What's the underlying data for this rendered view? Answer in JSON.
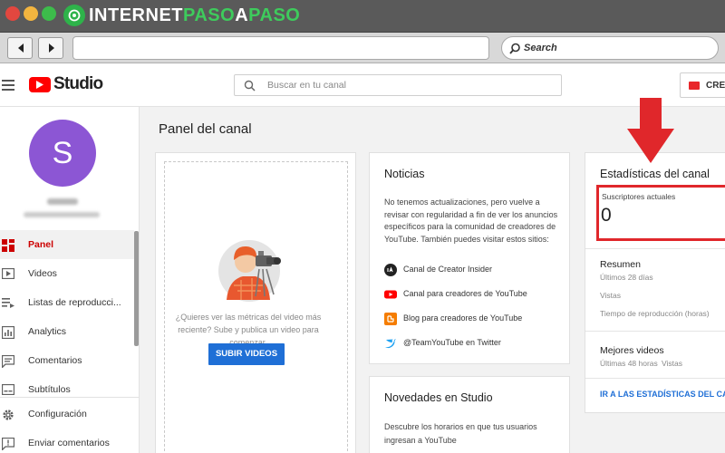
{
  "chrome": {
    "brand_part1": "INTERNET",
    "brand_part2": "PASO",
    "brand_part3": "A",
    "brand_part4": "PASO",
    "traffic_colors": [
      "#e2473f",
      "#f3b53f",
      "#3dbc4b"
    ],
    "brand_color": "#3ecb5c"
  },
  "browser": {
    "search_placeholder": "Search"
  },
  "header": {
    "app_name": "Studio",
    "search_placeholder": "Buscar en tu canal",
    "create_label": "CREA"
  },
  "sidebar": {
    "avatar_letter": "S",
    "avatar_color": "#8c56d4",
    "items": [
      {
        "label": "Panel",
        "icon": "dashboard-icon",
        "active": true
      },
      {
        "label": "Videos",
        "icon": "video-icon"
      },
      {
        "label": "Listas de reproducci...",
        "icon": "playlist-icon"
      },
      {
        "label": "Analytics",
        "icon": "analytics-icon"
      },
      {
        "label": "Comentarios",
        "icon": "comments-icon"
      },
      {
        "label": "Subtítulos",
        "icon": "subtitles-icon"
      },
      {
        "label": "Configuración",
        "icon": "gear-icon"
      },
      {
        "label": "Enviar comentarios",
        "icon": "feedback-icon"
      }
    ]
  },
  "main": {
    "page_title": "Panel del canal",
    "upload": {
      "text": "¿Quieres ver las métricas del video más reciente? Sube y publica un video para comenzar.",
      "button_label": "SUBIR VIDEOS",
      "button_color": "#1f6fd6"
    },
    "news": {
      "title": "Noticias",
      "text": "No tenemos actualizaciones, pero vuelve a revisar con regularidad a fin de ver los anuncios específicos para la comunidad de creadores de YouTube. También puedes visitar estos sitios:",
      "links": [
        {
          "label": "Canal de Creator Insider",
          "icon": "creator-insider-icon"
        },
        {
          "label": "Canal para creadores de YouTube",
          "icon": "youtube-icon"
        },
        {
          "label": "Blog para creadores de YouTube",
          "icon": "blogger-icon"
        },
        {
          "label": "@TeamYouTube en Twitter",
          "icon": "twitter-icon"
        }
      ]
    },
    "studio_news": {
      "title": "Novedades en Studio",
      "text": "Descubre los horarios en que tus usuarios ingresan a YouTube"
    },
    "stats": {
      "title": "Estadísticas del canal",
      "subscribers_label": "Suscriptores actuales",
      "subscribers_value": "0",
      "summary_title": "Resumen",
      "summary_period": "Últimos 28 días",
      "views_label": "Vistas",
      "watch_time_label": "Tiempo de reproducción (horas)",
      "top_videos_title": "Mejores videos",
      "top_videos_period": "Últimas 48 horas",
      "top_videos_views": "Vistas",
      "link_label": "IR A LAS ESTADÍSTICAS DEL CA",
      "highlight_color": "#e0272b"
    }
  }
}
